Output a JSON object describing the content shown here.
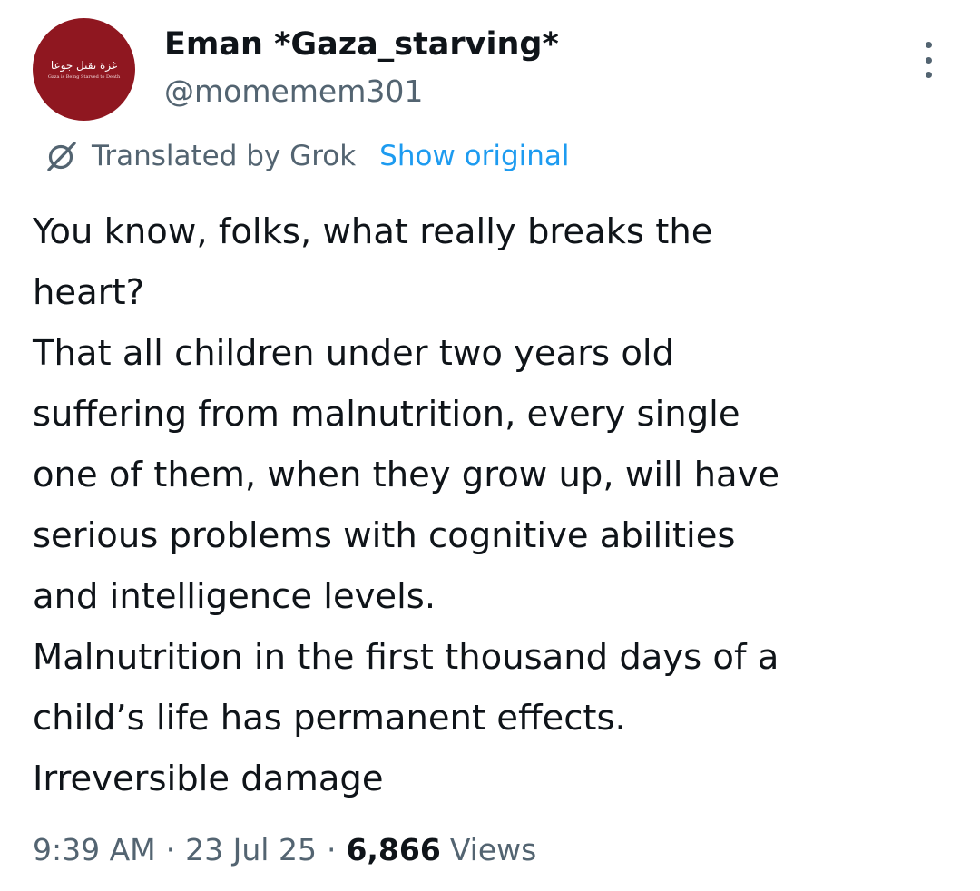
{
  "author": {
    "display_name": "Eman *Gaza_starving*",
    "handle": "@momemem301",
    "avatar": {
      "arabic_text": "غزة تقتل جوعا",
      "caption": "Gaza is Being Starved to Death",
      "background_color": "#8f1720"
    }
  },
  "translation": {
    "icon": "grok-icon",
    "label": "Translated by Grok",
    "action_label": "Show original"
  },
  "tweet": {
    "lines": [
      "You know, folks, what really breaks the",
      "heart?",
      "That all children under two years old",
      "suffering from malnutrition, every single",
      "one of them, when they grow up, will have",
      "serious problems with cognitive abilities",
      "and intelligence levels.",
      "Malnutrition in the first thousand days of a",
      "child’s life has permanent effects.",
      "Irreversible damage"
    ]
  },
  "meta": {
    "time": "9:39 AM",
    "separator": "·",
    "date": "23 Jul 25",
    "views_count": "6,866",
    "views_label": "Views"
  },
  "menu": {
    "icon": "more-options-icon"
  },
  "colors": {
    "text_primary": "#0f1419",
    "text_secondary": "#536471",
    "link": "#1d9bf0"
  }
}
